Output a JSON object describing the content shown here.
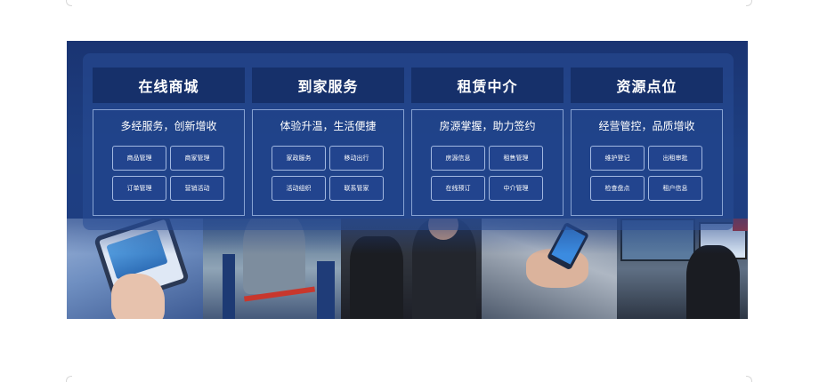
{
  "cards": [
    {
      "title": "在线商城",
      "subtitle": "多经服务，创新增收",
      "buttons": [
        "商品管理",
        "商家管理",
        "订单管理",
        "营销活动"
      ]
    },
    {
      "title": "到家服务",
      "subtitle": "体验升温，生活便捷",
      "buttons": [
        "家政服务",
        "移动出行",
        "活动组织",
        "联系管家"
      ]
    },
    {
      "title": "租赁中介",
      "subtitle": "房源掌握，助力签约",
      "buttons": [
        "房源信息",
        "租售管理",
        "在线预订",
        "中介管理"
      ]
    },
    {
      "title": "资源点位",
      "subtitle": "经营管控，品质增收",
      "buttons": [
        "维护登记",
        "出租审批",
        "检查盘点",
        "租户信息"
      ]
    }
  ],
  "colors": {
    "banner": "#1e3f82",
    "card_header": "#16306a",
    "text": "#ffffff"
  }
}
